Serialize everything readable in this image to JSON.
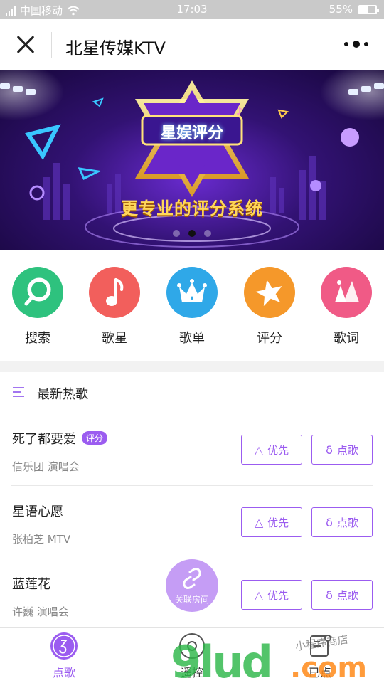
{
  "status_bar": {
    "carrier": "中国移动",
    "time": "17:03",
    "battery": "55%",
    "battery_level": 0.55
  },
  "header": {
    "title": "北星传媒KTV"
  },
  "banner": {
    "badge": "星娱评分",
    "subtitle": "更专业的评分系统",
    "page_count": 3,
    "active_page": 1
  },
  "quick_menu": [
    {
      "label": "搜索",
      "icon": "search-icon",
      "color": "#2ec27e"
    },
    {
      "label": "歌星",
      "icon": "music-note-icon",
      "color": "#f25f5c"
    },
    {
      "label": "歌单",
      "icon": "crown-icon",
      "color": "#2fa8e8"
    },
    {
      "label": "评分",
      "icon": "star-icon",
      "color": "#f5982a"
    },
    {
      "label": "歌词",
      "icon": "lyrics-icon",
      "color": "#f05a86"
    }
  ],
  "list": {
    "title": "最新热歌",
    "songs": [
      {
        "name": "死了都要爱",
        "tag": "评分",
        "artist": "信乐团 演唱会",
        "priority": "优先",
        "order": "点歌"
      },
      {
        "name": "星语心愿",
        "tag": "",
        "artist": "张柏芝 MTV",
        "priority": "优先",
        "order": "点歌"
      },
      {
        "name": "蓝莲花",
        "tag": "",
        "artist": "许巍 演唱会",
        "priority": "优先",
        "order": "点歌"
      }
    ]
  },
  "floating_button": {
    "label": "关联房间"
  },
  "tabbar": {
    "tabs": [
      {
        "label": "点歌",
        "active": true
      },
      {
        "label": "遥控",
        "active": false
      },
      {
        "label": "已点",
        "active": false
      }
    ]
  },
  "watermark": {
    "text": "9lud.com",
    "sub": "小程序商店"
  },
  "colors": {
    "accent": "#9b5cf0",
    "status_bar": "#c9c9c9"
  }
}
